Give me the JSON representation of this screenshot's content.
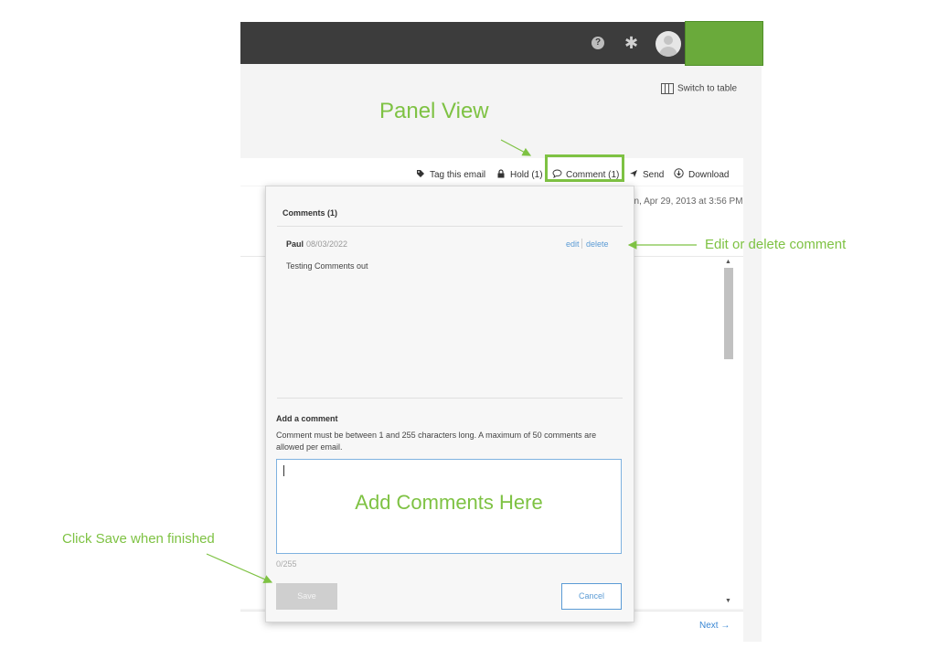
{
  "topbar": {
    "help_icon": "help-icon",
    "settings_icon": "gear-icon",
    "avatar_icon": "avatar-icon",
    "help_glyph": "?",
    "gear_glyph": "✱"
  },
  "view": {
    "switch_label": "Switch to table"
  },
  "toolbar": {
    "tag_label": "Tag this email",
    "hold_label": "Hold (1)",
    "comment_label": "Comment (1)",
    "send_label": "Send",
    "download_label": "Download"
  },
  "email": {
    "date_text": "on, Apr 29, 2013 at 3:56 PM"
  },
  "comments_panel": {
    "title": "Comments (1)",
    "comments": [
      {
        "author": "Paul",
        "date": "08/03/2022",
        "text": "Testing Comments out",
        "edit_label": "edit",
        "delete_label": "delete"
      }
    ],
    "add_title": "Add a comment",
    "add_hint": "Comment must be between 1 and 255 characters long. A maximum of 50 comments are allowed per email.",
    "textarea_value": "",
    "counter": "0/255",
    "save_label": "Save",
    "cancel_label": "Cancel"
  },
  "footer": {
    "next_label": "Next →"
  },
  "annotations": {
    "panel_view": "Panel View",
    "edit_delete": "Edit or delete comment",
    "add_here": "Add Comments Here",
    "save_hint": "Click Save when finished"
  },
  "colors": {
    "annotation_green": "#7ec243",
    "topbar": "#3c3c3c",
    "link_blue": "#5b9bd5"
  }
}
